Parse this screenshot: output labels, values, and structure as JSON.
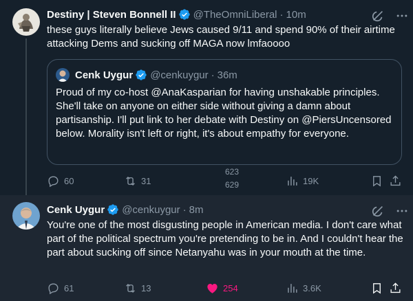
{
  "tweet1": {
    "author_name": "Destiny | Steven Bonnell II",
    "handle": "@TheOmniLiberal",
    "separator": "·",
    "time": "10m",
    "text": "these guys literally believe Jews caused 9/11 and spend 90% of their airtime attacking Dems and sucking off MAGA now lmfaoooo",
    "quote": {
      "author_name": "Cenk Uygur",
      "handle": "@cenkuygur",
      "separator": "·",
      "time": "36m",
      "text": "Proud of my co-host @AnaKasparian for having unshakable principles. She'll take on anyone on either side without giving a damn about partisanship. I'll put link to her debate with Destiny on @PiersUncensored below. Morality isn't left or right, it's about empathy for everyone."
    },
    "actions": {
      "replies": "60",
      "reposts": "31",
      "likes_top": "623",
      "likes_bottom": "629",
      "views": "19K"
    }
  },
  "tweet2": {
    "author_name": "Cenk Uygur",
    "handle": "@cenkuygur",
    "separator": "·",
    "time": "8m",
    "text": "You're one of the most disgusting people in American media. I don't care what part of the political spectrum you're pretending to be in. And I couldn't hear the part about sucking off since Netanyahu was in your mouth at the time.",
    "actions": {
      "replies": "61",
      "reposts": "13",
      "likes": "254",
      "views": "3.6K"
    }
  },
  "colors": {
    "background": "#15202b",
    "highlight": "#1e2732",
    "text": "#f7f9f9",
    "muted": "#8b98a5",
    "verified": "#1d9bf0",
    "like_active": "#f91880"
  }
}
